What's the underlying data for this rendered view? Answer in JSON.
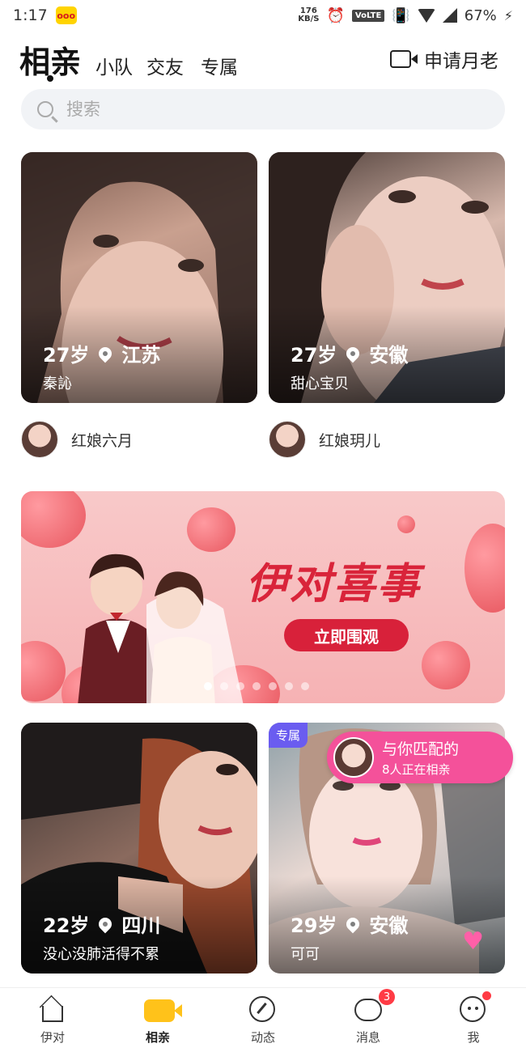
{
  "status_bar": {
    "time": "1:17",
    "app_badge_text": "ooo",
    "net_speed_value": "176",
    "net_speed_unit": "KB/S",
    "volte": "VoLTE",
    "battery": "67%"
  },
  "header": {
    "active_tab": "相亲",
    "tabs": [
      "小队",
      "交友",
      "专属"
    ],
    "apply_label": "申请月老"
  },
  "search": {
    "placeholder": "搜索"
  },
  "cards": [
    {
      "age": "27岁",
      "location": "江苏",
      "name": "秦訫"
    },
    {
      "age": "27岁",
      "location": "安徽",
      "name": "甜心宝贝"
    },
    {
      "age": "22岁",
      "location": "四川",
      "name": "没心没肺活得不累"
    },
    {
      "age": "29岁",
      "location": "安徽",
      "name": "可可",
      "badge": "专属"
    }
  ],
  "matchmakers": [
    "红娘六月",
    "红娘玥儿"
  ],
  "banner": {
    "title": "伊对喜事",
    "button": "立即围观",
    "dot_count": 7,
    "active_dot": 0
  },
  "match_pill": {
    "line1": "与你匹配的",
    "line2": "8人正在相亲"
  },
  "nav": {
    "items": [
      "伊对",
      "相亲",
      "动态",
      "消息",
      "我"
    ],
    "active": "相亲",
    "message_badge": "3"
  },
  "colors": {
    "accent_yellow": "#ffc21a",
    "banner_red": "#d8213a",
    "pill_pink": "#f4519a",
    "exclusive_purple": "#6a5cf0"
  }
}
